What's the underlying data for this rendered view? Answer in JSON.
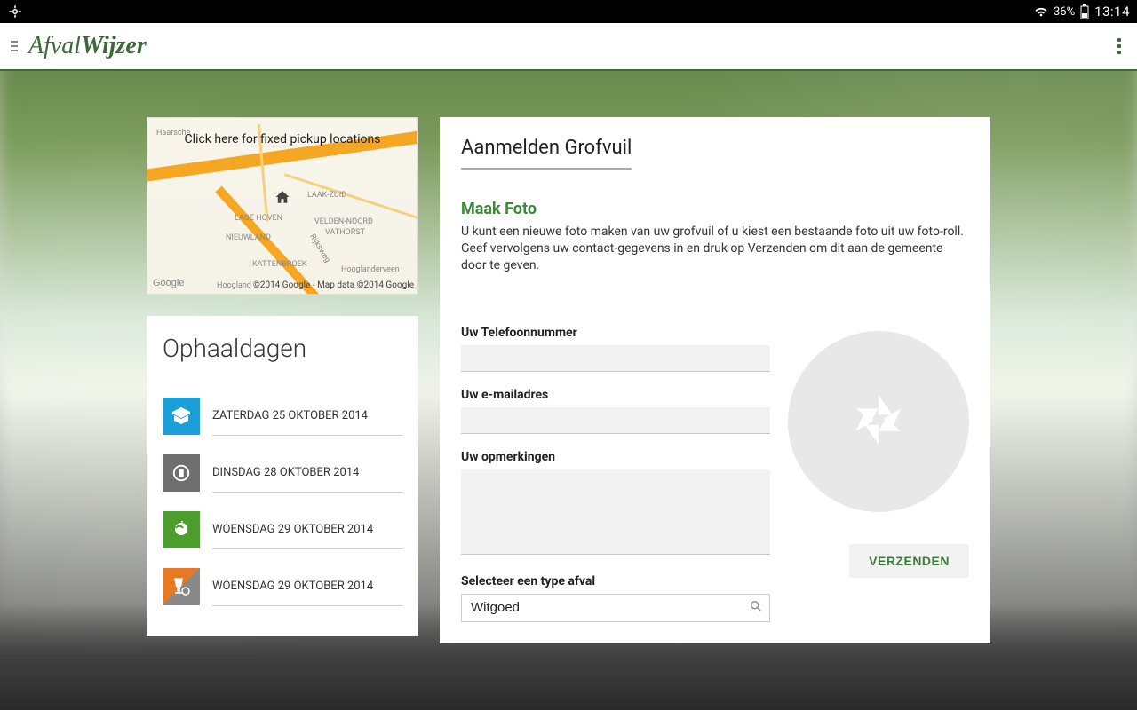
{
  "status": {
    "battery_pct": "36%",
    "time": "13:14"
  },
  "header": {
    "title_afval": "Afval",
    "title_wijzer": "Wijzer"
  },
  "map": {
    "overlay_text": "Click here for fixed pickup locations",
    "attribution": "©2014 Google - Map data ©2014 Google",
    "google_label": "Google",
    "labels": {
      "haarsche": "Haarsche",
      "laakzuid": "LAAK-ZUID",
      "lagehoven": "LAGE HOVEN",
      "nieuwland": "NIEUWLAND",
      "veldennoord": "VELDEN-NOORD",
      "vathorst": "VATHORST",
      "kattenbroek": "KATTENBROEK",
      "rijksweg": "Rijksweg",
      "hooglanderveen": "Hooglanderveen",
      "hoogland": "Hoogland"
    }
  },
  "pickup": {
    "title": "Ophaaldagen",
    "items": [
      {
        "date": "ZATERDAG 25 OKTOBER 2014",
        "color": "blue",
        "icon": "box-icon"
      },
      {
        "date": "DINSDAG 28 OKTOBER 2014",
        "color": "grey",
        "icon": "bin-icon"
      },
      {
        "date": "WOENSDAG 29 OKTOBER 2014",
        "color": "green",
        "icon": "organic-icon"
      },
      {
        "date": "WOENSDAG 29 OKTOBER 2014",
        "color": "orange",
        "icon": "glass-icon"
      }
    ]
  },
  "form": {
    "title": "Aanmelden Grofvuil",
    "section_heading": "Maak Foto",
    "section_desc": "U kunt een nieuwe foto maken van uw grofvuil of u kiest een bestaande foto uit uw foto-roll. Geef vervolgens uw contact-gegevens in en druk op Verzenden om dit aan de gemeente door te geven.",
    "labels": {
      "phone": "Uw Telefoonnummer",
      "email": "Uw e-mailadres",
      "remarks": "Uw opmerkingen",
      "type": "Selecteer een type afval"
    },
    "type_value": "Witgoed",
    "send_label": "VERZENDEN"
  }
}
